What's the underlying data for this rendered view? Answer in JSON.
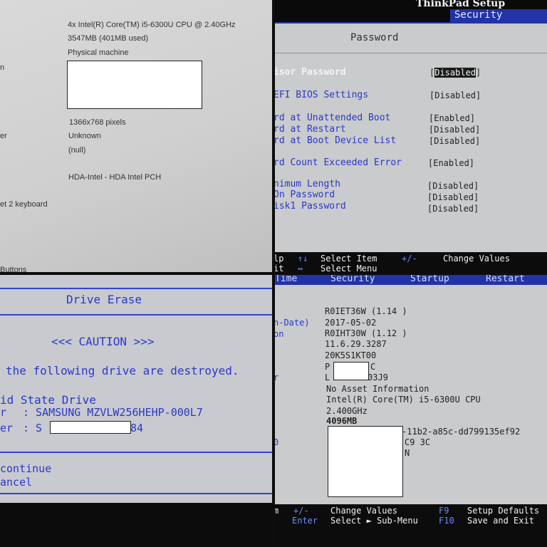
{
  "sysinfo": {
    "cpu": "4x Intel(R) Core(TM) i5-6300U CPU @ 2.40GHz",
    "memory": "3547MB (401MB used)",
    "machine_type": "Physical machine",
    "resolution": "1366x768 pixels",
    "unknown": "Unknown",
    "null_value": "(null)",
    "audio": "HDA-Intel - HDA Intel PCH",
    "label_n": "n",
    "label_er": "er",
    "label_keyboard": "et 2 keyboard",
    "label_buttons": "Buttons"
  },
  "password_page": {
    "header_title": "ThinkPad Setup",
    "active_tab": "Security",
    "title": "Password",
    "items": [
      {
        "label": "isor Password",
        "value": "[Disabled]"
      },
      {
        "label": "EFI BIOS Settings",
        "value": "[Disabled]"
      },
      {
        "label": "rd at Unattended Boot",
        "value": "[Enabled]"
      },
      {
        "label": "rd at Restart",
        "value": "[Disabled]"
      },
      {
        "label": "rd at Boot Device List",
        "value": "[Disabled]"
      },
      {
        "label": "rd Count Exceeded Error",
        "value": "[Enabled]"
      },
      {
        "label": "nimum Length",
        "value": "[Disabled]"
      },
      {
        "label": "On Password",
        "value": "[Disabled]"
      },
      {
        "label": "isk1 Password",
        "value": "[Disabled]"
      }
    ],
    "footer": {
      "help_key": "lp",
      "help_arrows": "↑↓",
      "select_item": "Select Item",
      "plusminus": "+/-",
      "change_values": "Change Values",
      "exit_key": "it",
      "exit_arrows": "↔",
      "select_menu": "Select Menu"
    }
  },
  "drive_erase": {
    "title": "Drive Erase",
    "caution": "<<< CAUTION >>>",
    "warning": "the following drive are destroyed.",
    "drive_type": "id State Drive",
    "model_label": "r",
    "model_value": ": SAMSUNG MZVLW256HEHP-000L7",
    "serial_label": "er",
    "serial_prefix": ": S",
    "serial_suffix": "84",
    "continue_label": "continue",
    "cancel_label": "ancel"
  },
  "main_info": {
    "tabs": [
      "Time",
      "Security",
      "Startup",
      "Restart"
    ],
    "labels": {
      "date_label": "n-Date)",
      "version_label": "on",
      "r_label": "r",
      "o_label": "0"
    },
    "values": {
      "bios_version": "R0IET36W (1.14 )",
      "bios_date": "2017-05-02",
      "ec_version": "R0IHT30W (1.12 )",
      "me_version": "11.6.29.3287",
      "machine_type": "20K5S1KT00",
      "serial_prefix": "P",
      "serial_suffix": "C",
      "system_board_prefix": "L",
      "system_board_suffix": "03J9",
      "asset_tag": "No Asset Information",
      "cpu_type": "Intel(R) Core(TM) i5-6300U CPU",
      "cpu_speed": "2.400GHz",
      "memory": "4096MB",
      "uuid_tail": "-11b2-a85c-dd799135ef92",
      "mac_tail": "C9 3C",
      "n_tail": "N"
    },
    "footer": {
      "plusminus": "+/-",
      "change_values": "Change Values",
      "f9": "F9",
      "setup_defaults": "Setup Defaults",
      "enter_key": "Enter",
      "select_submenu": "Select ► Sub-Menu",
      "f10": "F10",
      "save_exit": "Save and Exit",
      "left_key": "m"
    }
  }
}
